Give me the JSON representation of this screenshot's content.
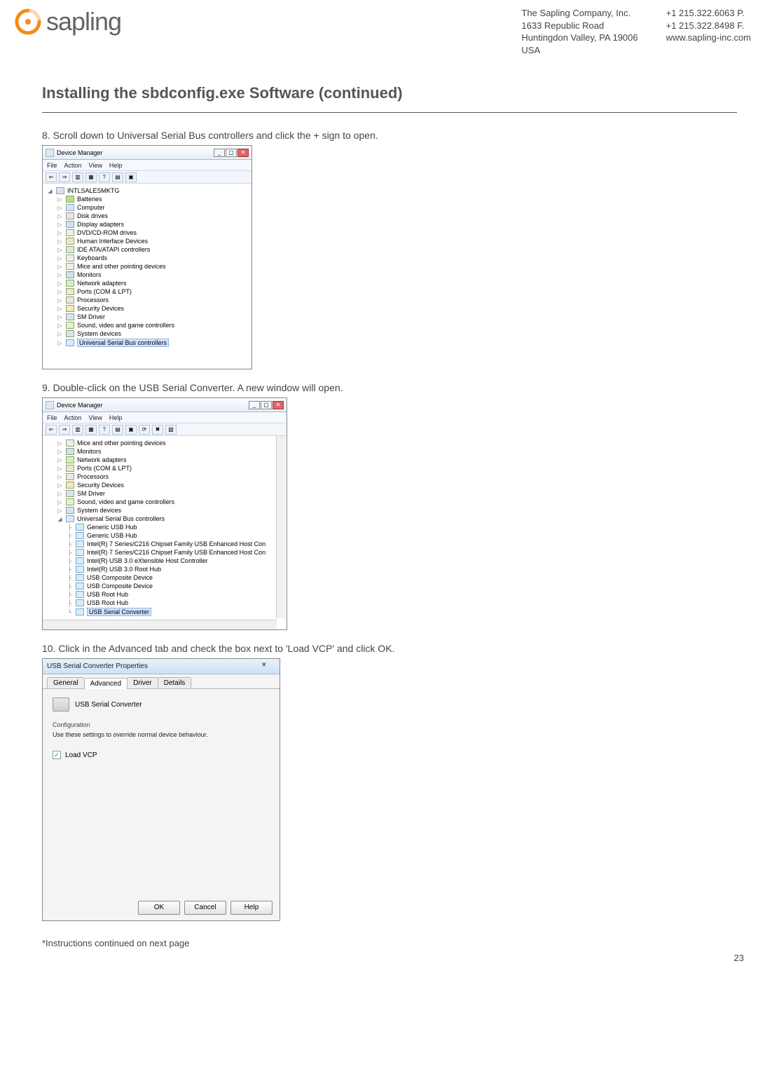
{
  "header": {
    "logo_text": "sapling",
    "company": "The Sapling Company, Inc.",
    "street": "1633 Republic Road",
    "citystate": "Huntingdon Valley, PA 19006",
    "country": "USA",
    "phone": "+1 215.322.6063 P.",
    "fax": "+1 215.322.8498 F.",
    "web": "www.sapling-inc.com"
  },
  "title": "Installing the sbdconfig.exe Software (continued)",
  "steps": {
    "s8": "8. Scroll down to Universal Serial Bus controllers and click the + sign to open.",
    "s9": "9. Double-click on the USB Serial Converter. A new window will open.",
    "s10": "10. Click in the Advanced tab and check the box next to 'Load VCP' and click OK."
  },
  "shot1": {
    "window_title": "Device Manager",
    "menus": [
      "File",
      "Action",
      "View",
      "Help"
    ],
    "root": "INTLSALESMKTG",
    "items": [
      {
        "label": "Batteries",
        "cls": "bat"
      },
      {
        "label": "Computer",
        "cls": "pc"
      },
      {
        "label": "Disk drives",
        "cls": "disk"
      },
      {
        "label": "Display adapters",
        "cls": "disp"
      },
      {
        "label": "DVD/CD-ROM drives",
        "cls": "dvd"
      },
      {
        "label": "Human Interface Devices",
        "cls": "hid"
      },
      {
        "label": "IDE ATA/ATAPI controllers",
        "cls": "ide"
      },
      {
        "label": "Keyboards",
        "cls": "kb"
      },
      {
        "label": "Mice and other pointing devices",
        "cls": "mouse"
      },
      {
        "label": "Monitors",
        "cls": "mon"
      },
      {
        "label": "Network adapters",
        "cls": "net"
      },
      {
        "label": "Ports (COM & LPT)",
        "cls": "port"
      },
      {
        "label": "Processors",
        "cls": "proc"
      },
      {
        "label": "Security Devices",
        "cls": "sec"
      },
      {
        "label": "SM Driver",
        "cls": "sm"
      },
      {
        "label": "Sound, video and game controllers",
        "cls": "snd"
      },
      {
        "label": "System devices",
        "cls": "sys"
      }
    ],
    "selected": "Universal Serial Bus controllers"
  },
  "shot2": {
    "window_title": "Device Manager",
    "menus": [
      "File",
      "Action",
      "View",
      "Help"
    ],
    "upper": [
      {
        "label": "Mice and other pointing devices",
        "cls": "mouse"
      },
      {
        "label": "Monitors",
        "cls": "mon"
      },
      {
        "label": "Network adapters",
        "cls": "net"
      },
      {
        "label": "Ports (COM & LPT)",
        "cls": "port"
      },
      {
        "label": "Processors",
        "cls": "proc"
      },
      {
        "label": "Security Devices",
        "cls": "sec"
      },
      {
        "label": "SM Driver",
        "cls": "sm"
      },
      {
        "label": "Sound, video and game controllers",
        "cls": "snd"
      },
      {
        "label": "System devices",
        "cls": "sys"
      }
    ],
    "usb_parent": "Universal Serial Bus controllers",
    "usb_children": [
      "Generic USB Hub",
      "Generic USB Hub",
      "Intel(R) 7 Series/C216 Chipset Family USB Enhanced Host Con",
      "Intel(R) 7 Series/C216 Chipset Family USB Enhanced Host Con",
      "Intel(R) USB 3.0 eXtensible Host Controller",
      "Intel(R) USB 3.0 Root Hub",
      "USB Composite Device",
      "USB Composite Device",
      "USB Root Hub",
      "USB Root Hub"
    ],
    "selected": "USB Serial Converter"
  },
  "shot3": {
    "window_title": "USB Serial Converter Properties",
    "tabs": [
      "General",
      "Advanced",
      "Driver",
      "Details"
    ],
    "active_tab": "Advanced",
    "device_name": "USB Serial Converter",
    "config_label": "Configuration",
    "config_desc": "Use these settings to override normal device behaviour.",
    "checkbox_label": "Load VCP",
    "buttons": [
      "OK",
      "Cancel",
      "Help"
    ]
  },
  "footer": "*Instructions continued on next page",
  "page_number": "23"
}
